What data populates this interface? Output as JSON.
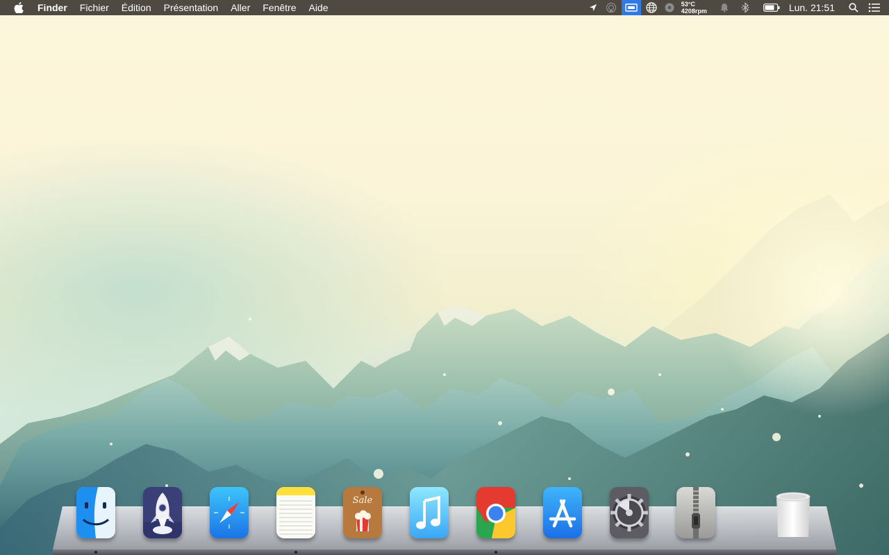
{
  "menubar": {
    "apple_icon": "apple-icon",
    "app_name": "Finder",
    "menus": [
      "Fichier",
      "Édition",
      "Présentation",
      "Aller",
      "Fenêtre",
      "Aide"
    ],
    "status_icons": [
      "location-arrow-icon",
      "airplay-icon",
      "display-mirroring-icon",
      "globe-icon",
      "fan-gear-icon",
      "notification-bell-icon",
      "bluetooth-icon",
      "battery-icon"
    ],
    "temperature": "53°C",
    "fan_speed": "4208rpm",
    "clock": "Lun. 21:51",
    "search_icon": "spotlight-search-icon",
    "list_icon": "notification-center-icon",
    "bar_color": "#4e4a42",
    "active_icon_color": "#2f7ae5"
  },
  "dock": {
    "items": [
      {
        "name": "Finder",
        "icon": "finder-icon",
        "running": true
      },
      {
        "name": "Launchpad",
        "icon": "rocket-icon",
        "running": false
      },
      {
        "name": "Safari",
        "icon": "compass-icon",
        "running": false
      },
      {
        "name": "Notes",
        "icon": "notes-icon",
        "running": true
      },
      {
        "name": "Popcorn Time",
        "icon": "sale-tag-icon",
        "running": false
      },
      {
        "name": "iTunes",
        "icon": "music-note-icon",
        "running": false
      },
      {
        "name": "Google Chrome",
        "icon": "chrome-icon",
        "running": true
      },
      {
        "name": "App Store",
        "icon": "app-store-icon",
        "running": false
      },
      {
        "name": "System Preferences",
        "icon": "gear-icon",
        "running": false
      },
      {
        "name": "Archive Utility",
        "icon": "zipper-icon",
        "running": false
      },
      {
        "name": "Trash",
        "icon": "trash-icon",
        "running": false
      }
    ],
    "sale_text": "Sale"
  }
}
